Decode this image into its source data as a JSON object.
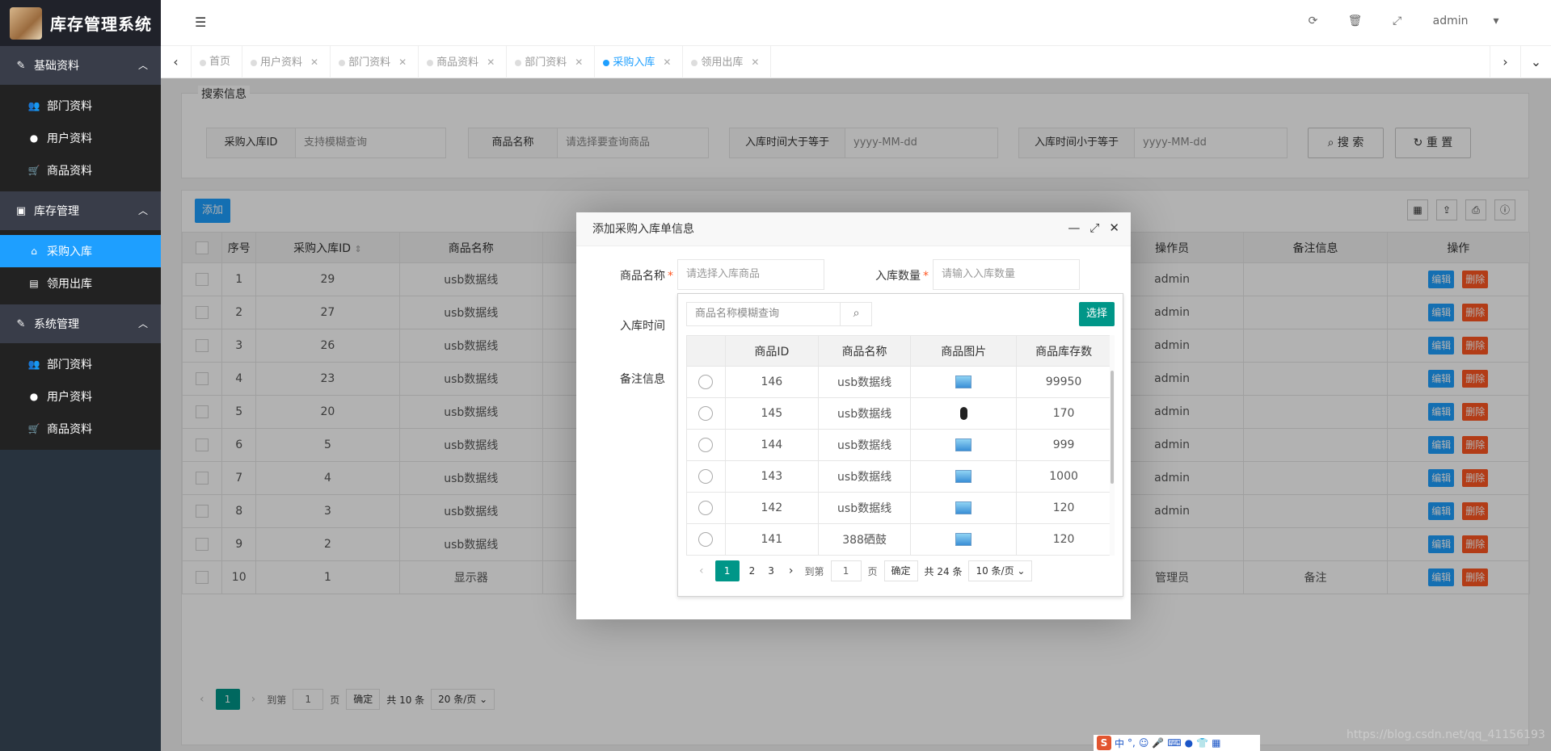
{
  "app": {
    "title": "库存管理系统"
  },
  "sidebar": {
    "groups": [
      {
        "label": "基础资料",
        "icon": "edit-icon",
        "items": [
          "部门资料",
          "用户资料",
          "商品资料"
        ]
      },
      {
        "label": "库存管理",
        "icon": "warehouse-icon",
        "items": [
          "采购入库",
          "领用出库"
        ]
      },
      {
        "label": "系统管理",
        "icon": "edit-icon",
        "items": [
          "部门资料",
          "用户资料",
          "商品资料"
        ]
      }
    ],
    "active_item": "采购入库"
  },
  "header": {
    "user": "admin"
  },
  "tabs": [
    {
      "label": "首页"
    },
    {
      "label": "用户资料"
    },
    {
      "label": "部门资料"
    },
    {
      "label": "商品资料"
    },
    {
      "label": "部门资料"
    },
    {
      "label": "采购入库",
      "active": true
    },
    {
      "label": "领用出库"
    }
  ],
  "search": {
    "legend": "搜索信息",
    "fields": [
      {
        "label": "采购入库ID",
        "placeholder": "支持模糊查询"
      },
      {
        "label": "商品名称",
        "placeholder": "请选择要查询商品"
      },
      {
        "label": "入库时间大于等于",
        "placeholder": "yyyy-MM-dd"
      },
      {
        "label": "入库时间小于等于",
        "placeholder": "yyyy-MM-dd"
      }
    ],
    "search_btn": "搜 索",
    "reset_btn": "重 置"
  },
  "table": {
    "add_btn": "添加",
    "headers": [
      "序号",
      "采购入库ID",
      "商品名称",
      "操作员",
      "备注信息",
      "操作"
    ],
    "rows": [
      {
        "no": "1",
        "id": "29",
        "name": "usb数据线",
        "operator": "admin",
        "note": ""
      },
      {
        "no": "2",
        "id": "27",
        "name": "usb数据线",
        "operator": "admin",
        "note": ""
      },
      {
        "no": "3",
        "id": "26",
        "name": "usb数据线",
        "operator": "admin",
        "note": ""
      },
      {
        "no": "4",
        "id": "23",
        "name": "usb数据线",
        "operator": "admin",
        "note": ""
      },
      {
        "no": "5",
        "id": "20",
        "name": "usb数据线",
        "operator": "admin",
        "note": ""
      },
      {
        "no": "6",
        "id": "5",
        "name": "usb数据线",
        "operator": "admin",
        "note": ""
      },
      {
        "no": "7",
        "id": "4",
        "name": "usb数据线",
        "operator": "admin",
        "note": ""
      },
      {
        "no": "8",
        "id": "3",
        "name": "usb数据线",
        "operator": "admin",
        "note": ""
      },
      {
        "no": "9",
        "id": "2",
        "name": "usb数据线",
        "operator": "",
        "note": ""
      },
      {
        "no": "10",
        "id": "1",
        "name": "显示器",
        "operator": "管理员",
        "note": "备注"
      }
    ],
    "edit_label": "编辑",
    "delete_label": "删除",
    "pager": {
      "current": "1",
      "goto": "到第",
      "page_input": "1",
      "page_unit": "页",
      "confirm": "确定",
      "total": "共 10 条",
      "size": "20 条/页"
    }
  },
  "dialog": {
    "title": "添加采购入库单信息",
    "goods_label": "商品名称",
    "goods_placeholder": "请选择入库商品",
    "qty_label": "入库数量",
    "qty_placeholder": "请输入入库数量",
    "time_label": "入库时间",
    "note_label": "备注信息",
    "picker": {
      "search_placeholder": "商品名称模糊查询",
      "select_btn": "选择",
      "headers": [
        "商品ID",
        "商品名称",
        "商品图片",
        "商品库存数"
      ],
      "rows": [
        {
          "id": "146",
          "name": "usb数据线",
          "img": "monitor",
          "stock": "99950"
        },
        {
          "id": "145",
          "name": "usb数据线",
          "img": "mouse",
          "stock": "170"
        },
        {
          "id": "144",
          "name": "usb数据线",
          "img": "monitor",
          "stock": "999"
        },
        {
          "id": "143",
          "name": "usb数据线",
          "img": "monitor",
          "stock": "1000"
        },
        {
          "id": "142",
          "name": "usb数据线",
          "img": "monitor",
          "stock": "120"
        },
        {
          "id": "141",
          "name": "388硒鼓",
          "img": "monitor",
          "stock": "120"
        }
      ],
      "pager": {
        "pages": [
          "1",
          "2",
          "3"
        ],
        "goto": "到第",
        "page_input": "1",
        "page_unit": "页",
        "confirm": "确定",
        "total": "共 24 条",
        "size": "10 条/页"
      }
    }
  },
  "ime": {
    "label": "中"
  },
  "watermark": "https://blog.csdn.net/qq_41156193"
}
